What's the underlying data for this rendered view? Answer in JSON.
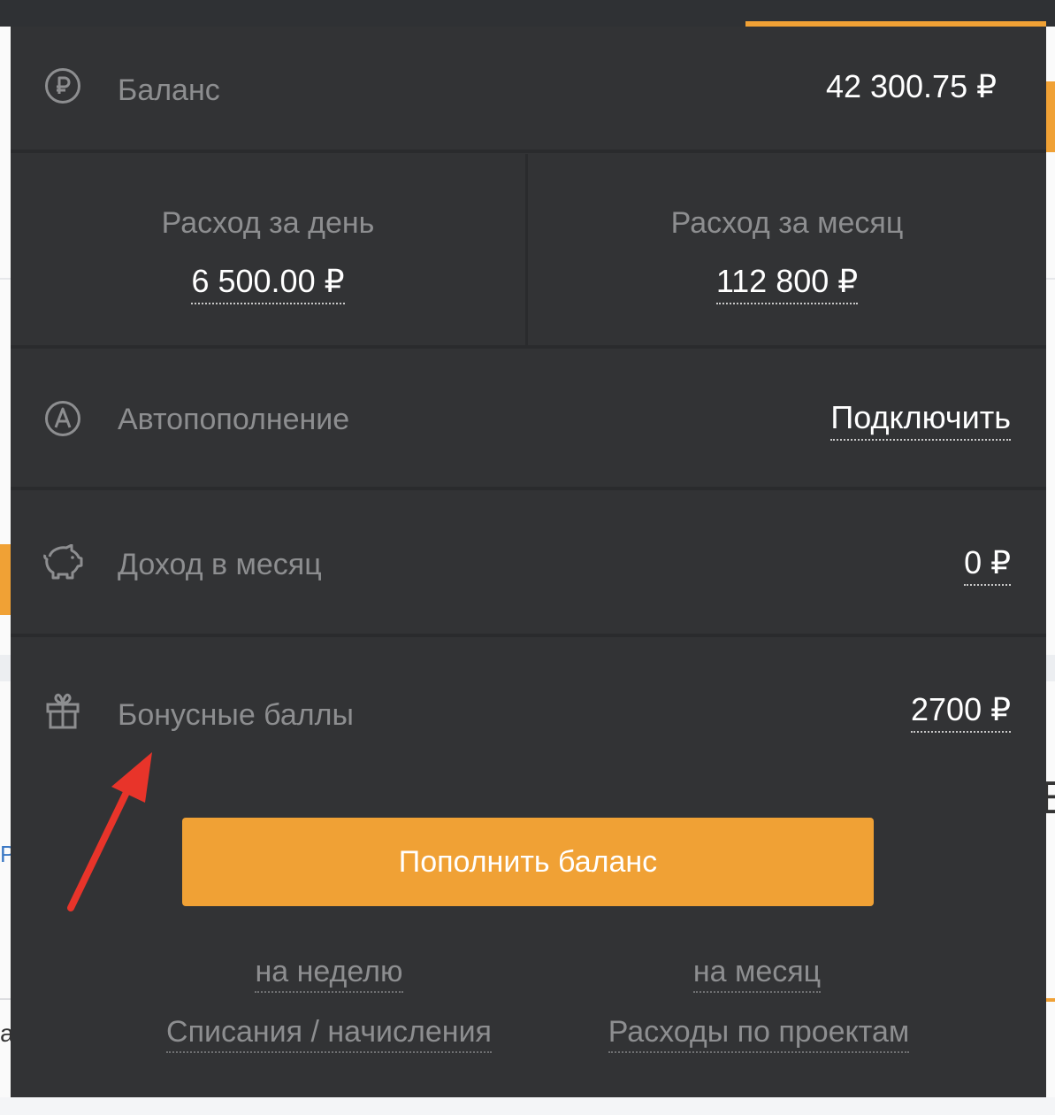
{
  "balance": {
    "label": "Баланс",
    "value": "42 300.75 ₽",
    "icon": "ruble-circle-icon"
  },
  "spend": {
    "day": {
      "label": "Расход за день",
      "value": "6 500.00 ₽"
    },
    "month": {
      "label": "Расход за месяц",
      "value": "112 800 ₽"
    }
  },
  "autotopup": {
    "label": "Автопополнение",
    "action": "Подключить",
    "icon": "autopay-a-circle-icon"
  },
  "income": {
    "label": "Доход в месяц",
    "value": "0 ₽",
    "icon": "piggy-bank-icon"
  },
  "bonus": {
    "label": "Бонусные баллы",
    "value": "2700 ₽",
    "icon": "gift-icon"
  },
  "actions": {
    "topup_label": "Пополнить баланс",
    "week_link": "на неделю",
    "month_link": "на месяц",
    "transactions_link": "Списания / начисления",
    "projects_link": "Расходы по проектам"
  },
  "background": {
    "left_char": "Р",
    "left_text": "а",
    "right_char": "В"
  },
  "colors": {
    "panel": "#323335",
    "accent": "#f0a135",
    "label": "#8d8e90",
    "annotation_arrow": "#e8342a"
  }
}
